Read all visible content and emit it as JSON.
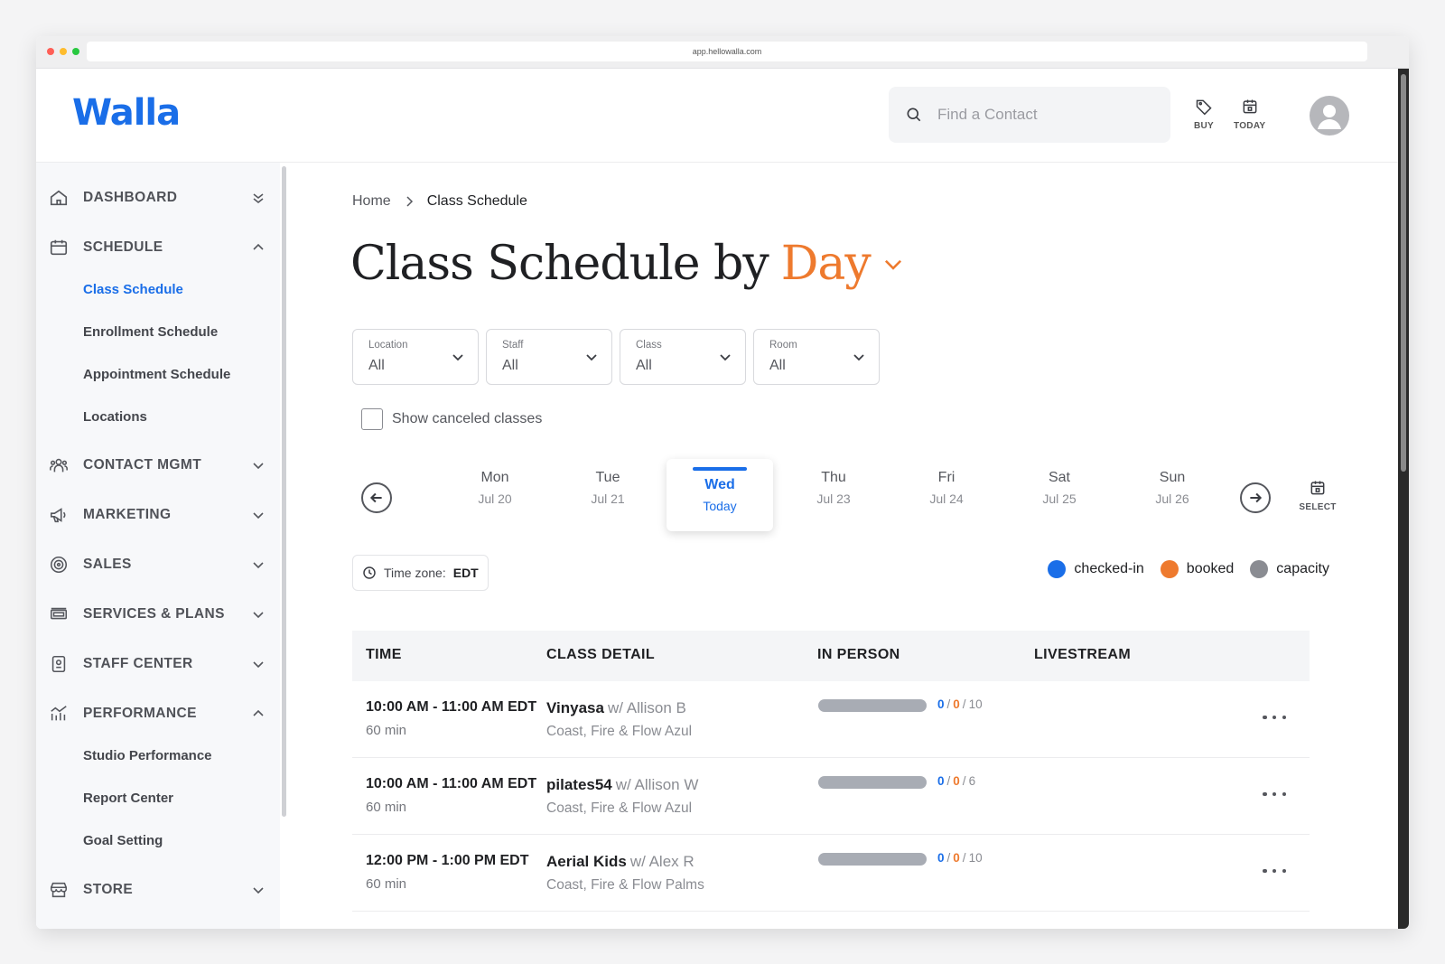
{
  "browser": {
    "url": "app.hellowalla.com"
  },
  "header": {
    "logo": "Walla",
    "search_placeholder": "Find a Contact",
    "buy_label": "BUY",
    "today_label": "TODAY"
  },
  "sidebar": {
    "sections": [
      {
        "label": "DASHBOARD"
      },
      {
        "label": "SCHEDULE"
      },
      {
        "label": "CONTACT MGMT"
      },
      {
        "label": "MARKETING"
      },
      {
        "label": "SALES"
      },
      {
        "label": "SERVICES & PLANS"
      },
      {
        "label": "STAFF CENTER"
      },
      {
        "label": "PERFORMANCE"
      },
      {
        "label": "STORE"
      }
    ],
    "schedule_items": [
      "Class Schedule",
      "Enrollment Schedule",
      "Appointment Schedule",
      "Locations"
    ],
    "performance_items": [
      "Studio Performance",
      "Report Center",
      "Goal Setting"
    ]
  },
  "breadcrumb": {
    "home": "Home",
    "current": "Class Schedule"
  },
  "page_title": {
    "prefix": "Class Schedule by",
    "accent": "Day"
  },
  "filters": [
    {
      "label": "Location",
      "value": "All"
    },
    {
      "label": "Staff",
      "value": "All"
    },
    {
      "label": "Class",
      "value": "All"
    },
    {
      "label": "Room",
      "value": "All"
    }
  ],
  "show_canceled_label": "Show canceled classes",
  "days": [
    {
      "name": "Mon",
      "date": "Jul 20"
    },
    {
      "name": "Tue",
      "date": "Jul 21"
    },
    {
      "name": "Wed",
      "date": "Today"
    },
    {
      "name": "Thu",
      "date": "Jul 23"
    },
    {
      "name": "Fri",
      "date": "Jul 24"
    },
    {
      "name": "Sat",
      "date": "Jul 25"
    },
    {
      "name": "Sun",
      "date": "Jul 26"
    }
  ],
  "select_label": "SELECT",
  "timezone": {
    "label": "Time zone:",
    "value": "EDT"
  },
  "legend": [
    {
      "label": "checked-in",
      "color": "#1a6ee8"
    },
    {
      "label": "booked",
      "color": "#ee7a2e"
    },
    {
      "label": "capacity",
      "color": "#8a8c92"
    }
  ],
  "table": {
    "headers": [
      "TIME",
      "CLASS DETAIL",
      "IN PERSON",
      "LIVESTREAM"
    ],
    "rows": [
      {
        "time": "10:00 AM - 11:00 AM EDT",
        "duration": "60 min",
        "class": "Vinyasa",
        "instructor": "w/ Allison B",
        "location": "Coast, Fire & Flow Azul",
        "checked_in": "0",
        "booked": "0",
        "capacity": "10",
        "fill": 0
      },
      {
        "time": "10:00 AM - 11:00 AM EDT",
        "duration": "60 min",
        "class": "pilates54",
        "instructor": "w/ Allison W",
        "location": "Coast, Fire & Flow Azul",
        "checked_in": "0",
        "booked": "0",
        "capacity": "6",
        "fill": 0
      },
      {
        "time": "12:00 PM - 1:00 PM EDT",
        "duration": "60 min",
        "class": "Aerial Kids",
        "instructor": "w/ Alex R",
        "location": "Coast, Fire & Flow Palms",
        "checked_in": "0",
        "booked": "0",
        "capacity": "10",
        "fill": 0
      }
    ]
  }
}
